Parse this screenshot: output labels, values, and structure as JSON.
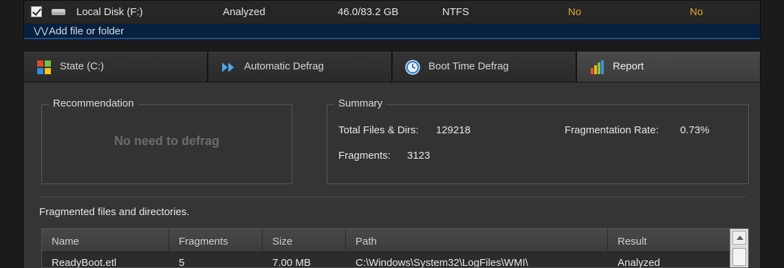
{
  "disk_row": {
    "name": "Local Disk (F:)",
    "status": "Analyzed",
    "size": "46.0/83.2 GB",
    "fs": "NTFS",
    "col5": "No",
    "col6": "No",
    "checked": true
  },
  "add_row": {
    "chevron": "»",
    "label": "Add file or folder"
  },
  "tabs": [
    {
      "label": "State (C:)",
      "icon": "windows-logo-icon"
    },
    {
      "label": "Automatic Defrag",
      "icon": "fast-forward-icon"
    },
    {
      "label": "Boot Time Defrag",
      "icon": "clock-icon"
    },
    {
      "label": "Report",
      "icon": "bar-chart-icon",
      "active": true
    }
  ],
  "recommendation": {
    "title": "Recommendation",
    "message": "No need to defrag"
  },
  "summary": {
    "title": "Summary",
    "total_label": "Total Files & Dirs:",
    "total_value": "129218",
    "fragments_label": "Fragments:",
    "fragments_value": "3123",
    "rate_label": "Fragmentation Rate:",
    "rate_value": "0.73%"
  },
  "fragmented": {
    "title": "Fragmented files and directories.",
    "columns": [
      "Name",
      "Fragments",
      "Size",
      "Path",
      "Result"
    ],
    "rows": [
      {
        "name": "ReadyBoot.etl",
        "fragments": "5",
        "size": "7.00 MB",
        "path": "C:\\Windows\\System32\\LogFiles\\WMI\\",
        "result": "Analyzed"
      }
    ]
  },
  "colors": {
    "accent_no": "#e6a630",
    "add_row_bg": "#07203f"
  }
}
